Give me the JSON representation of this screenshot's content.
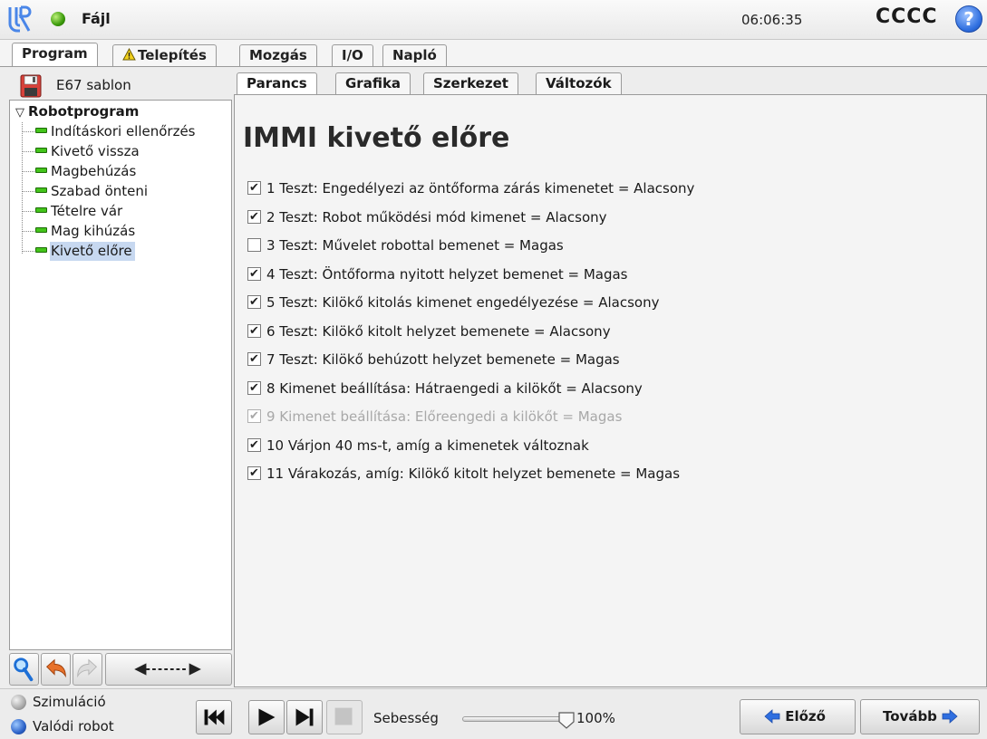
{
  "header": {
    "file_label": "Fájl",
    "clock": "06:06:35",
    "robot_name": "CCCC",
    "help_label": "?"
  },
  "main_tabs": [
    {
      "label": "Program",
      "active": true
    },
    {
      "label": "Telepítés",
      "warning": true
    },
    {
      "label": "Mozgás"
    },
    {
      "label": "I/O"
    },
    {
      "label": "Napló"
    }
  ],
  "left": {
    "program_name": "E67 sablon",
    "tree_root": "Robotprogram",
    "tree_items": [
      {
        "label": "Indításkori ellenőrzés"
      },
      {
        "label": "Kivető vissza"
      },
      {
        "label": "Magbehúzás"
      },
      {
        "label": "Szabad önteni"
      },
      {
        "label": "Tételre vár"
      },
      {
        "label": "Mag kihúzás"
      },
      {
        "label": "Kivető előre",
        "selected": true
      }
    ],
    "toolbar_icons": [
      "search-icon",
      "undo-icon",
      "redo-icon",
      "collapse-arrow-icon"
    ]
  },
  "sub_tabs": [
    {
      "label": "Parancs",
      "active": true
    },
    {
      "label": "Grafika"
    },
    {
      "label": "Szerkezet"
    },
    {
      "label": "Változók"
    }
  ],
  "content": {
    "heading": "IMMI kivető előre",
    "conditions": [
      {
        "text": "1 Teszt: Engedélyezi az öntőforma zárás kimenetet = Alacsony",
        "checked": true
      },
      {
        "text": "2 Teszt: Robot működési mód kimenet = Alacsony",
        "checked": true
      },
      {
        "text": "3 Teszt: Művelet robottal bemenet = Magas",
        "checked": false
      },
      {
        "text": "4 Teszt: Öntőforma nyitott helyzet bemenet = Magas",
        "checked": true
      },
      {
        "text": "5 Teszt: Kilökő kitolás kimenet engedélyezése = Alacsony",
        "checked": true
      },
      {
        "text": "6 Teszt: Kilökő kitolt helyzet bemenete = Alacsony",
        "checked": true
      },
      {
        "text": "7 Teszt: Kilökő behúzott helyzet bemenete = Magas",
        "checked": true
      },
      {
        "text": "8 Kimenet beállítása: Hátraengedi a kilökőt = Alacsony",
        "checked": true
      },
      {
        "text": "9 Kimenet beállítása: Előreengedi a kilökőt = Magas",
        "checked": true,
        "disabled": true
      },
      {
        "text": "10 Várjon 40 ms-t, amíg a kimenetek változnak",
        "checked": true
      },
      {
        "text": "11 Várakozás, amíg: Kilökő kitolt helyzet bemenete = Magas",
        "checked": true
      }
    ]
  },
  "bottom": {
    "simulation_label": "Szimuláció",
    "real_robot_label": "Valódi robot",
    "mode_selected": "Valódi robot",
    "speed_label": "Sebesség",
    "speed_value": "100%",
    "speed_fraction": 1.0,
    "prev_label": "Előző",
    "next_label": "Tovább"
  },
  "colors": {
    "accent": "#2f6fe0",
    "status_ok": "#3a9a0a",
    "node_green": "#43c41a",
    "selection": "#c7d8f0"
  }
}
